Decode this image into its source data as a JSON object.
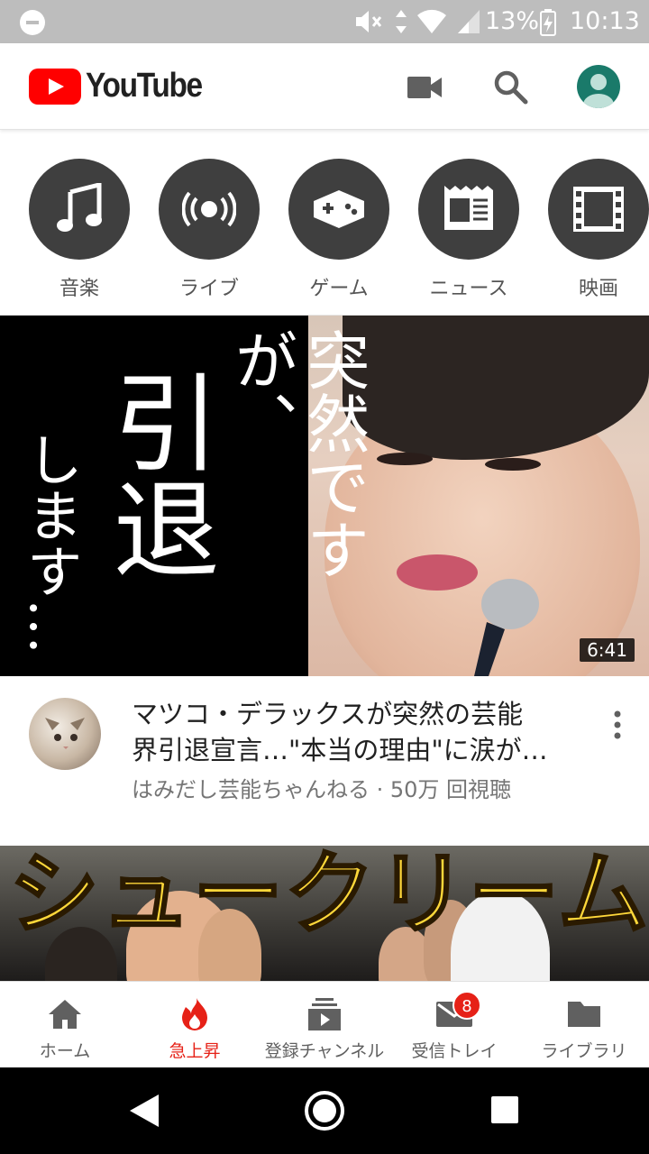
{
  "status_bar": {
    "battery_percent": "13%",
    "time": "10:13"
  },
  "app_bar": {
    "logo_text": "YouTube",
    "brand_color": "#ff0000"
  },
  "categories": [
    {
      "label": "音楽",
      "icon": "music-note-icon"
    },
    {
      "label": "ライブ",
      "icon": "live-broadcast-icon"
    },
    {
      "label": "ゲーム",
      "icon": "gamepad-icon"
    },
    {
      "label": "ニュース",
      "icon": "newspaper-icon"
    },
    {
      "label": "映画",
      "icon": "film-icon"
    }
  ],
  "videos": [
    {
      "thumbnail_text": {
        "col1": "突然ですが、",
        "col2": "引退",
        "col3": "します…"
      },
      "duration": "6:41",
      "title_line1": "マツコ・デラックスが突然の芸能",
      "title_line2": "界引退宣言…\"本当の理由\"に涙が…",
      "meta": "はみだし芸能ちゃんねる · 50万 回視聴"
    },
    {
      "thumbnail_text": "シュークリーム"
    }
  ],
  "bottom_nav": [
    {
      "label": "ホーム",
      "icon": "home-icon",
      "active": false
    },
    {
      "label": "急上昇",
      "icon": "trending-fire-icon",
      "active": true
    },
    {
      "label": "登録チャンネル",
      "icon": "subscriptions-icon",
      "active": false
    },
    {
      "label": "受信トレイ",
      "icon": "inbox-mail-icon",
      "active": false,
      "badge": "8"
    },
    {
      "label": "ライブラリ",
      "icon": "library-folder-icon",
      "active": false
    }
  ],
  "colors": {
    "active_red": "#e62117",
    "icon_grey": "#606060",
    "category_circle": "#3f3f3f"
  }
}
